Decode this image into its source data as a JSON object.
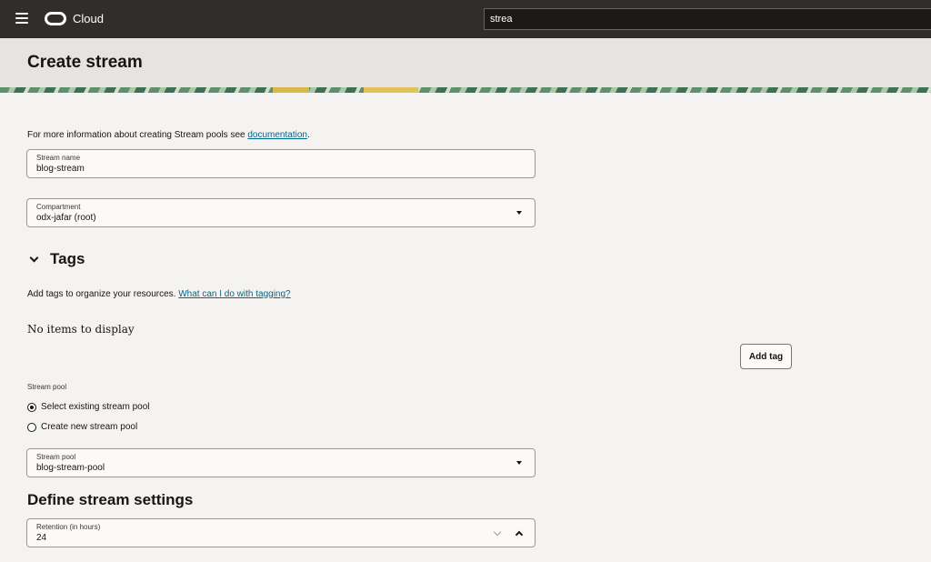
{
  "topbar": {
    "brand": "Cloud",
    "search_value": "strea"
  },
  "page": {
    "title": "Create stream",
    "info_text": "For more information about creating Stream pools see ",
    "info_link": "documentation",
    "info_suffix": "."
  },
  "form": {
    "stream_name": {
      "label": "Stream name",
      "value": "blog-stream"
    },
    "compartment": {
      "label": "Compartment",
      "value": "odx-jafar (root)"
    }
  },
  "tags": {
    "title": "Tags",
    "info_text": "Add tags to organize your resources. ",
    "info_link": "What can I do with tagging?",
    "empty_text": "No items to display",
    "add_button": "Add tag"
  },
  "stream_pool": {
    "section_label": "Stream pool",
    "options": [
      {
        "label": "Select existing stream pool",
        "selected": true
      },
      {
        "label": "Create new stream pool",
        "selected": false
      }
    ],
    "select": {
      "label": "Stream pool",
      "value": "blog-stream-pool"
    }
  },
  "settings": {
    "title": "Define stream settings",
    "retention": {
      "label": "Retention (in hours)",
      "value": "24"
    }
  }
}
